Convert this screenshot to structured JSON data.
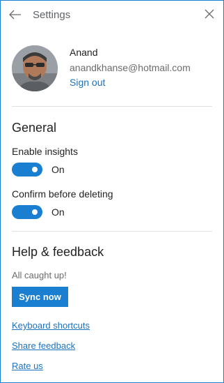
{
  "header": {
    "title": "Settings",
    "back_icon": "arrow-left-icon",
    "close_icon": "close-icon"
  },
  "account": {
    "name": "Anand",
    "email": "anandkhanse@hotmail.com",
    "sign_out_label": "Sign out"
  },
  "general": {
    "heading": "General",
    "settings": [
      {
        "label": "Enable insights",
        "state": "On",
        "enabled": true
      },
      {
        "label": "Confirm before deleting",
        "state": "On",
        "enabled": true
      }
    ]
  },
  "help": {
    "heading": "Help & feedback",
    "status": "All caught up!",
    "sync_label": "Sync now",
    "links": [
      "Keyboard shortcuts",
      "Share feedback",
      "Rate us"
    ]
  },
  "colors": {
    "accent": "#1a7fd0",
    "link": "#1b72c0",
    "border": "#1a7fd0"
  }
}
